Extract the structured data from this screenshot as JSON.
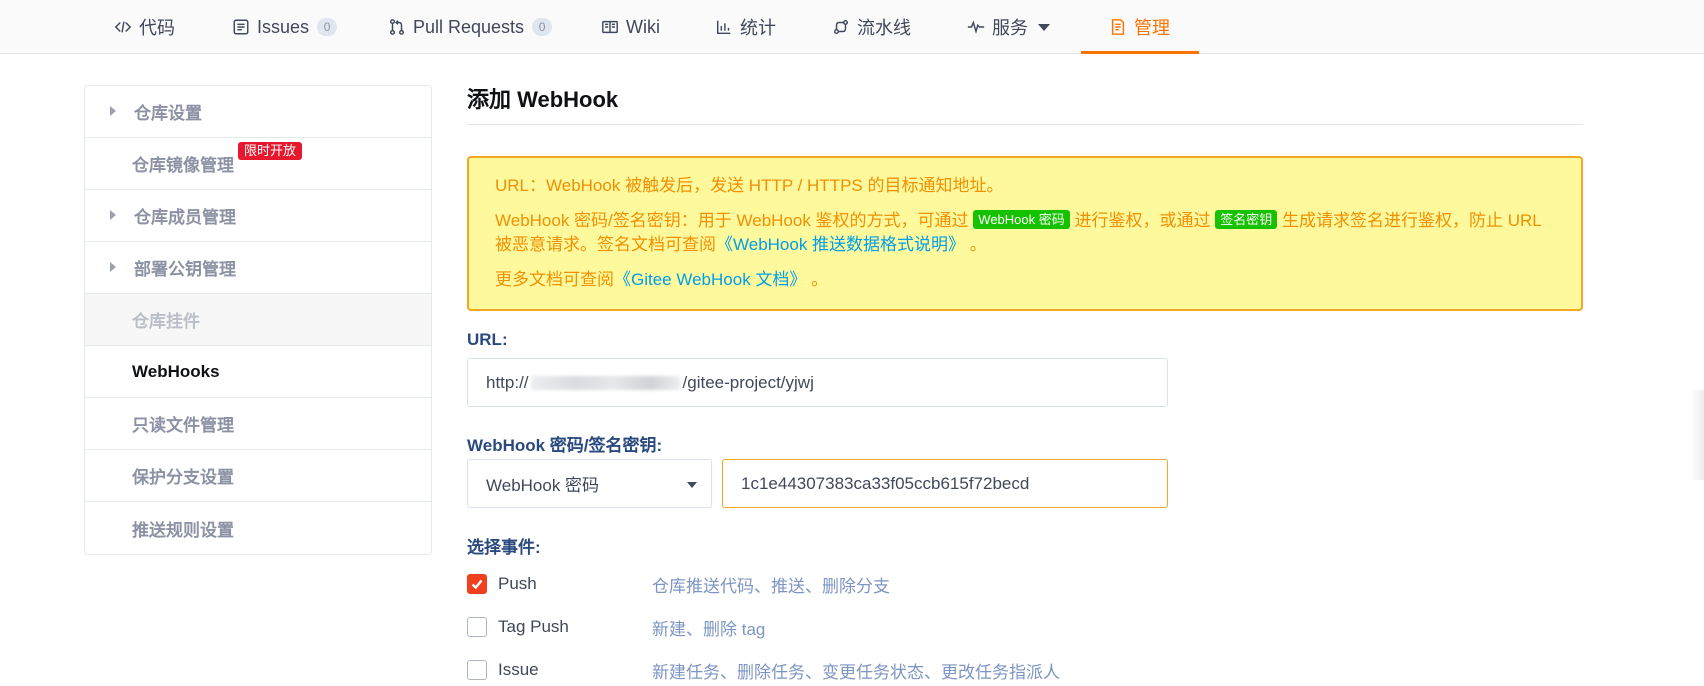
{
  "nav": {
    "tabs": [
      {
        "label": "代码",
        "icon": "code-icon"
      },
      {
        "label": "Issues",
        "count": "0",
        "icon": "issues-icon"
      },
      {
        "label": "Pull Requests",
        "count": "0",
        "icon": "pull-request-icon"
      },
      {
        "label": "Wiki",
        "icon": "wiki-icon"
      },
      {
        "label": "统计",
        "icon": "bar-chart-icon"
      },
      {
        "label": "流水线",
        "icon": "pipeline-icon"
      },
      {
        "label": "服务",
        "icon": "pulse-icon"
      },
      {
        "label": "管理",
        "icon": "manage-icon",
        "active": true
      }
    ],
    "accent_color": "#fe7300"
  },
  "sidebar": {
    "items": [
      {
        "label": "仓库设置"
      },
      {
        "label": "仓库镜像管理",
        "badge": "限时开放"
      },
      {
        "label": "仓库成员管理"
      },
      {
        "label": "部署公钥管理"
      },
      {
        "label": "仓库挂件"
      },
      {
        "label": "WebHooks"
      },
      {
        "label": "只读文件管理"
      },
      {
        "label": "保护分支设置"
      },
      {
        "label": "推送规则设置"
      }
    ]
  },
  "main": {
    "title": "添加 WebHook",
    "notice": {
      "line1": "URL：WebHook 被触发后，发送 HTTP / HTTPS 的目标通知地址。",
      "line2_a": "WebHook 密码/签名密钥：用于 WebHook 鉴权的方式，可通过",
      "tag1": "WebHook 密码",
      "line2_b": "进行鉴权，或通过",
      "tag2": "签名密钥",
      "line2_c": "生成请求签名进行鉴权，防止 URL 被恶意请求。签名文档可查阅",
      "link1": "《WebHook 推送数据格式说明》",
      "line2_d": "。",
      "line3_a": "更多文档可查阅",
      "link2": "《Gitee WebHook 文档》",
      "line3_b": "。"
    },
    "url_label": "URL:",
    "url_prefix": "http://",
    "url_suffix": "/gitee-project/yjwj",
    "secret_label": "WebHook 密码/签名密钥:",
    "secret_type": "WebHook 密码",
    "secret_value": "1c1e44307383ca33f05ccb615f72becd",
    "events_label": "选择事件:",
    "events": [
      {
        "name": "Push",
        "desc": "仓库推送代码、推送、删除分支",
        "checked": true
      },
      {
        "name": "Tag Push",
        "desc": "新建、删除 tag",
        "checked": false
      },
      {
        "name": "Issue",
        "desc": "新建任务、删除任务、变更任务状态、更改任务指派人",
        "checked": false
      }
    ],
    "checkbox_color": "#f0401f"
  }
}
